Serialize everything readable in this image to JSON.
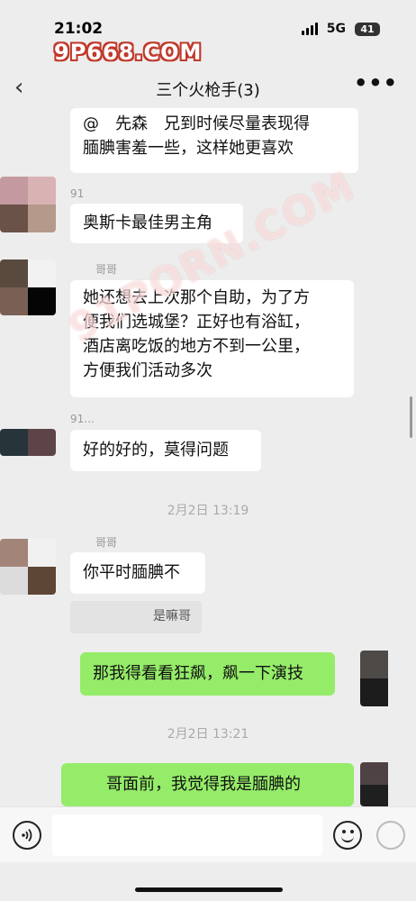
{
  "status_bar": {
    "time": "21:02",
    "network": "5G",
    "battery": "41"
  },
  "watermarks": {
    "top": "9P668.COM",
    "diagonal": "91PORN.COM"
  },
  "header": {
    "title": "三个火枪手(3)"
  },
  "messages": [
    {
      "sender": "",
      "text": "@　先森　兄到时候尽量表现得\n腼腆害羞一些，这样她更喜欢"
    },
    {
      "sender": "91",
      "text": "奥斯卡最佳男主角"
    },
    {
      "sender": "哥哥",
      "text": "她还想去上次那个自助，为了方\n便我们选城堡？正好也有浴缸，\n酒店离吃饭的地方不到一公里，\n方便我们活动多次"
    },
    {
      "sender": "91...",
      "text": "好的好的，莫得问题"
    },
    {
      "sender": "哥哥",
      "text": "你平时腼腆不",
      "quote": "是嘛哥"
    },
    {
      "text": "那我得看看狂飙，飙一下演技"
    },
    {
      "text": "　　哥面前，我觉得我是腼腆的"
    }
  ],
  "timestamps": [
    "2月2日 13:19",
    "2月2日 13:21"
  ],
  "colors": {
    "outgoing_bubble": "#95ec69",
    "incoming_bubble": "#ffffff",
    "background": "#ededed"
  }
}
